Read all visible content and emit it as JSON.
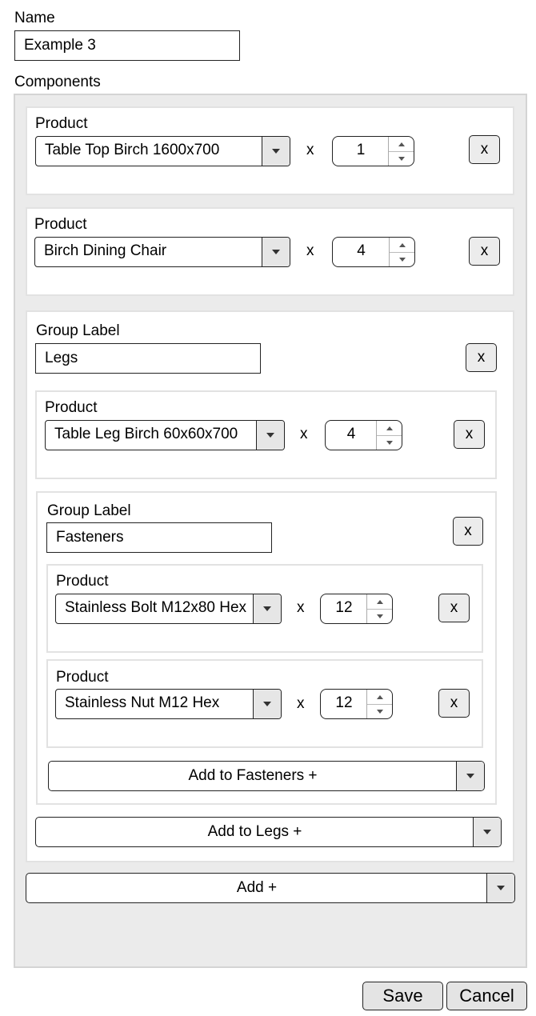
{
  "name": {
    "label": "Name",
    "value": "Example 3"
  },
  "components_label": "Components",
  "times_symbol": "x",
  "remove_label": "x",
  "p1": {
    "label": "Product",
    "value": "Table Top Birch 1600x700",
    "qty": "1"
  },
  "p2": {
    "label": "Product",
    "value": "Birch Dining Chair",
    "qty": "4"
  },
  "g1": {
    "label": "Group Label",
    "value": "Legs",
    "p1": {
      "label": "Product",
      "value": "Table Leg Birch 60x60x700",
      "qty": "4"
    },
    "g2": {
      "label": "Group Label",
      "value": "Fasteners",
      "p1": {
        "label": "Product",
        "value": "Stainless Bolt M12x80 Hex",
        "qty": "12"
      },
      "p2": {
        "label": "Product",
        "value": "Stainless Nut M12 Hex",
        "qty": "12"
      },
      "add_label": "Add to Fasteners +"
    },
    "add_label": "Add to Legs +"
  },
  "add_label": "Add +",
  "footer": {
    "save": "Save",
    "cancel": "Cancel"
  },
  "colors": {
    "outer_panel": "#ebebeb",
    "arrow_bg": "#e6e6e6",
    "button_bg": "#e4e4e4",
    "border": "#222222"
  }
}
